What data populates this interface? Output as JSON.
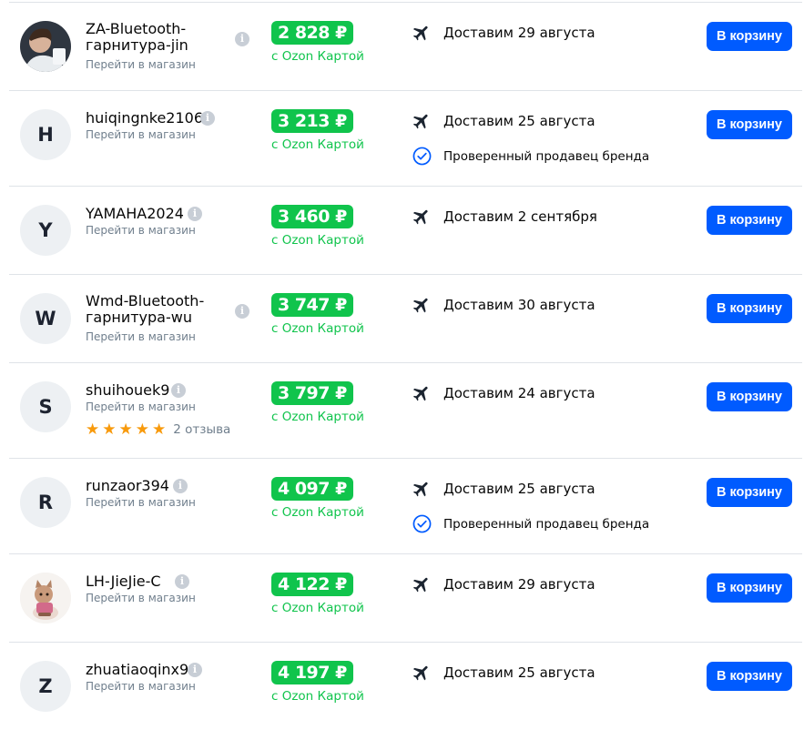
{
  "offers": [
    {
      "name": "ZA-Bluetooth-гарнитура-jin",
      "store_link": "Перейти в магазин",
      "price": "2 828 ₽",
      "card_note": "с Ozon Картой",
      "delivery": "Доставим 29 августа",
      "verified": "",
      "cart_label": "В корзину",
      "avatar_letter": ""
    },
    {
      "name": "huiqingnke2106",
      "store_link": "Перейти в магазин",
      "price": "3 213 ₽",
      "card_note": "с Ozon Картой",
      "delivery": "Доставим 25 августа",
      "verified": "Проверенный продавец бренда",
      "cart_label": "В корзину",
      "avatar_letter": "H"
    },
    {
      "name": "YAMAHA2024",
      "store_link": "Перейти в магазин",
      "price": "3 460 ₽",
      "card_note": "с Ozon Картой",
      "delivery": "Доставим 2 сентября",
      "verified": "",
      "cart_label": "В корзину",
      "avatar_letter": "Y"
    },
    {
      "name": "Wmd-Bluetooth-гарнитура-wu",
      "store_link": "Перейти в магазин",
      "price": "3 747 ₽",
      "card_note": "с Ozon Картой",
      "delivery": "Доставим 30 августа",
      "verified": "",
      "cart_label": "В корзину",
      "avatar_letter": "W"
    },
    {
      "name": "shuihouek9",
      "store_link": "Перейти в магазин",
      "price": "3 797 ₽",
      "card_note": "с Ozon Картой",
      "delivery": "Доставим 24 августа",
      "verified": "",
      "cart_label": "В корзину",
      "avatar_letter": "S",
      "rating": 5,
      "reviews": "2 отзыва"
    },
    {
      "name": "runzaor394",
      "store_link": "Перейти в магазин",
      "price": "4 097 ₽",
      "card_note": "с Ozon Картой",
      "delivery": "Доставим 25 августа",
      "verified": "Проверенный продавец бренда",
      "cart_label": "В корзину",
      "avatar_letter": "R"
    },
    {
      "name": "LH-JieJie-C",
      "store_link": "Перейти в магазин",
      "price": "4 122 ₽",
      "card_note": "с Ozon Картой",
      "delivery": "Доставим 29 августа",
      "verified": "",
      "cart_label": "В корзину",
      "avatar_letter": ""
    },
    {
      "name": "zhuatiaoqinx9",
      "store_link": "Перейти в магазин",
      "price": "4 197 ₽",
      "card_note": "с Ozon Картой",
      "delivery": "Доставим 25 августа",
      "verified": "",
      "cart_label": "В корзину",
      "avatar_letter": "Z"
    }
  ],
  "colors": {
    "accent": "#005bff",
    "price_green": "#10c44c",
    "muted": "#707f8d",
    "star": "#f89a0c"
  },
  "icons": {
    "delivery": "airplane-icon",
    "verified": "check-circle-icon",
    "info": "info-icon",
    "rating": "star-icon"
  }
}
